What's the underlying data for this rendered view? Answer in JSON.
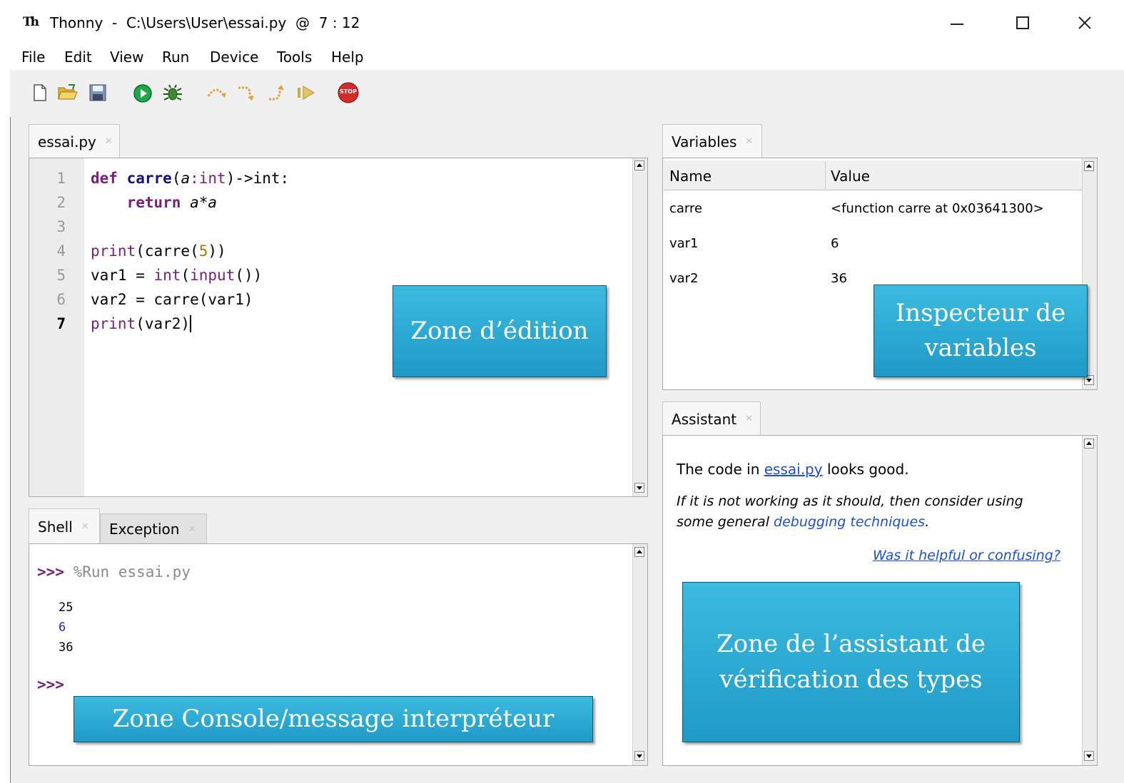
{
  "window": {
    "title": "Thonny  -  C:\\Users\\User\\essai.py  @  7 : 12",
    "logo": "Th",
    "controls": {
      "minimize": "—",
      "maximize": "☐",
      "close": "✕"
    }
  },
  "menu": [
    "File",
    "Edit",
    "View",
    "Run",
    "Device",
    "Tools",
    "Help"
  ],
  "toolbar": {
    "icons": [
      "new-file-icon",
      "open-file-icon",
      "save-icon",
      "run-icon",
      "debug-icon",
      "step-over-icon",
      "step-into-icon",
      "step-out-icon",
      "resume-icon",
      "stop-icon"
    ],
    "stop_label": "STOP"
  },
  "editor": {
    "tab": "essai.py",
    "line_numbers": [
      "1",
      "2",
      "3",
      "4",
      "5",
      "6",
      "7"
    ],
    "lines": [
      "def carre(a:int)->int:",
      "    return a*a",
      "",
      "print(carre(5))",
      "var1 = int(input())",
      "var2 = carre(var1)",
      "print(var2)"
    ],
    "tok": {
      "def": "def",
      "carre": "carre",
      "open_paren": "(",
      "a": "a",
      "colon_int": ":int",
      "close_arrow": ")->int:",
      "return": "return",
      "a1": "a",
      "star": "*",
      "a2": "a",
      "print4": "print",
      "l4b": "(carre(",
      "five": "5",
      "l4c": "))",
      "l5a": "var1 = ",
      "int5": "int",
      "l5b": "(",
      "input5": "input",
      "l5c": "())",
      "l6": "var2 = carre(var1)",
      "print7": "print",
      "l7": "(var2)"
    }
  },
  "variables": {
    "tab": "Variables",
    "headers": {
      "name": "Name",
      "value": "Value"
    },
    "rows": [
      {
        "name": "carre",
        "value": "<function carre at 0x03641300>"
      },
      {
        "name": "var1",
        "value": "6"
      },
      {
        "name": "var2",
        "value": "36"
      }
    ]
  },
  "assistant": {
    "tab": "Assistant",
    "line1_pre": "The code in ",
    "line1_link": "essai.py",
    "line1_post": " looks good.",
    "line2": "If it is not working as it should, then consider using",
    "line3_pre": "some general ",
    "line3_link": "debugging techniques",
    "line3_post": ".",
    "feedback": "Was it helpful or confusing?"
  },
  "shell": {
    "tabs": [
      "Shell",
      "Exception"
    ],
    "prompt": ">>>",
    "command": " %Run essai.py",
    "outputs": [
      "25",
      "6",
      "36"
    ],
    "prompt2": ">>>"
  },
  "annotations": {
    "edit": "Zone d’édition",
    "vars_1": "Inspecteur de",
    "vars_2": "variables",
    "console": "Zone Console/message interpréteur",
    "assistant_1": "Zone de l’assistant de",
    "assistant_2": "vérification des types"
  },
  "colors": {
    "annotation": "#29a9d6",
    "keyword": "#7a1e7a",
    "number": "#c07000",
    "link": "#1a4fd6",
    "input_echo": "#2323d6"
  }
}
